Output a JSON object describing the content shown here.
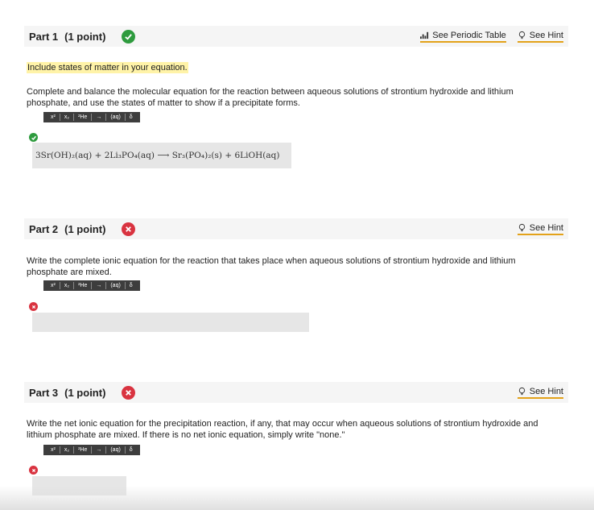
{
  "part1": {
    "title": "Part 1",
    "points": "(1 point)",
    "status": "correct",
    "periodic_link": "See Periodic Table",
    "hint_link": "See Hint",
    "highlight": "Include states of matter in your equation.",
    "question": "Complete and balance the molecular equation for the reaction between aqueous solutions of strontium hydroxide and lithium phosphate, and use the states of matter to show if a precipitate forms.",
    "answer_equation": "3Sr(OH)₂(aq) + 2Li₃PO₄(aq) ⟶ Sr₃(PO₄)₂(s) + 6LiOH(aq)"
  },
  "part2": {
    "title": "Part 2",
    "points": "(1 point)",
    "status": "incorrect",
    "hint_link": "See Hint",
    "question": "Write the complete ionic equation for the reaction that takes place when aqueous solutions of strontium hydroxide and lithium phosphate are mixed."
  },
  "part3": {
    "title": "Part 3",
    "points": "(1 point)",
    "status": "incorrect",
    "hint_link": "See Hint",
    "question": "Write the net ionic equation for the precipitation reaction, if any, that may occur when aqueous solutions of strontium hydroxide and lithium phosphate are mixed. If there is no net ionic equation, simply write \"none.\""
  },
  "toolbar": {
    "superscript": "x²",
    "subscript": "x₂",
    "element": "²He",
    "arrow": "→",
    "state": "(aq)",
    "charge": "δ"
  },
  "colors": {
    "correct": "#2e9b3e",
    "incorrect": "#d93340",
    "link_underline": "#e3a21a",
    "highlight": "#fff3a8"
  }
}
